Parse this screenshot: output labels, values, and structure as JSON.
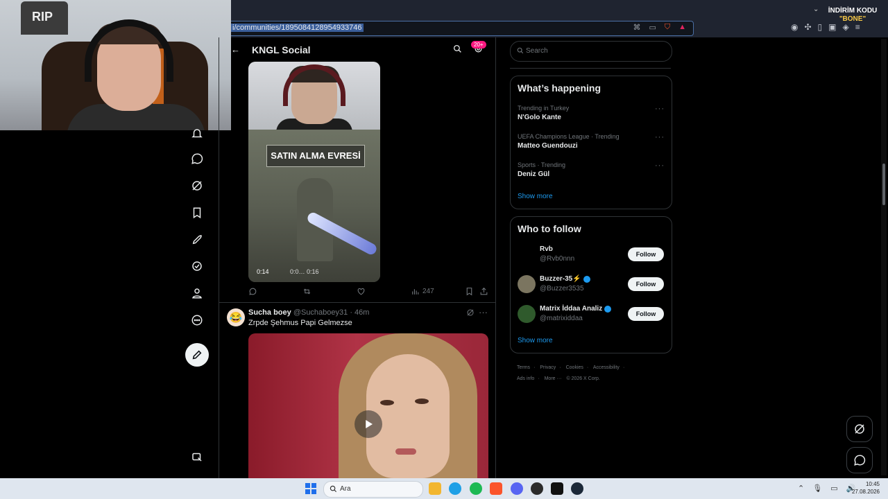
{
  "browser": {
    "url": "i/communities/1895084128954933746",
    "promo_line1": "İNDİRİM KODU",
    "promo_line2": "\"BONE\""
  },
  "webcam": {
    "sign_text": "RIP"
  },
  "feed": {
    "title": "KNGL Social",
    "badge": "20+",
    "post1": {
      "video_banner": "SATIN ALMA EVRESİ",
      "video_time": "0:14",
      "video_controls": "0:0… 0:16",
      "views": "247"
    },
    "post2": {
      "name": "Sucha boey",
      "handle": "@Suchaboey31 · 46m",
      "text": "Zrpde Şehmus Papi Gelmezse",
      "avatar_glyph": "😂"
    }
  },
  "sidebar_right": {
    "search_placeholder": "Search",
    "whats_happening": {
      "title": "What’s happening",
      "trends": [
        {
          "context": "Trending in Turkey",
          "name": "N'Golo Kante"
        },
        {
          "context": "UEFA Champions League · Trending",
          "name": "Matteo Guendouzi"
        },
        {
          "context": "Sports · Trending",
          "name": "Deniz Gül"
        }
      ],
      "show_more": "Show more"
    },
    "who_to_follow": {
      "title": "Who to follow",
      "users": [
        {
          "name": "Rvb",
          "handle": "@Rvb0nnn",
          "verified": false,
          "button": "Follow"
        },
        {
          "name": "Buzzer-35⚡",
          "handle": "@Buzzer3535",
          "verified": true,
          "button": "Follow"
        },
        {
          "name": "Matrix İddaa Analiz",
          "handle": "@matrixiddaa",
          "verified": true,
          "button": "Follow"
        }
      ],
      "show_more": "Show more"
    },
    "footer": {
      "links": [
        "Terms",
        "Privacy",
        "Cookies",
        "Accessibility",
        "Ads info",
        "More ···",
        "© 2026 X Corp."
      ]
    }
  },
  "taskbar": {
    "search_placeholder": "Ara",
    "time": "10:45",
    "date": "27.08.2026"
  },
  "colors": {
    "accent": "#1d9bf0",
    "background": "#000000",
    "badge": "#f91880"
  }
}
